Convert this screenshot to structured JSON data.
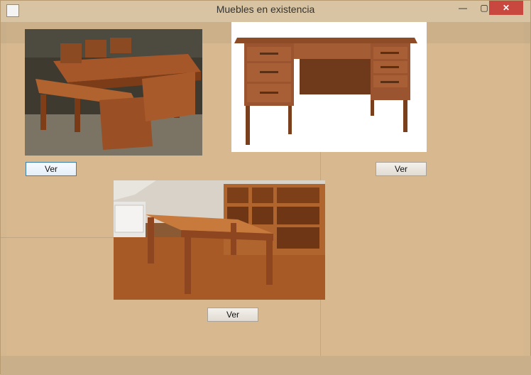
{
  "window": {
    "title": "Muebles en existencia",
    "minimize_glyph": "—",
    "maximize_glyph": "▢",
    "close_glyph": "✕"
  },
  "products": [
    {
      "name": "dining-table-with-benches",
      "button_label": "Ver"
    },
    {
      "name": "office-desk",
      "button_label": "Ver"
    },
    {
      "name": "wooden-table",
      "button_label": "Ver"
    }
  ],
  "colors": {
    "window_background": "#d8b98f",
    "close_button": "#c8473f",
    "wood": "#9b4f22"
  }
}
